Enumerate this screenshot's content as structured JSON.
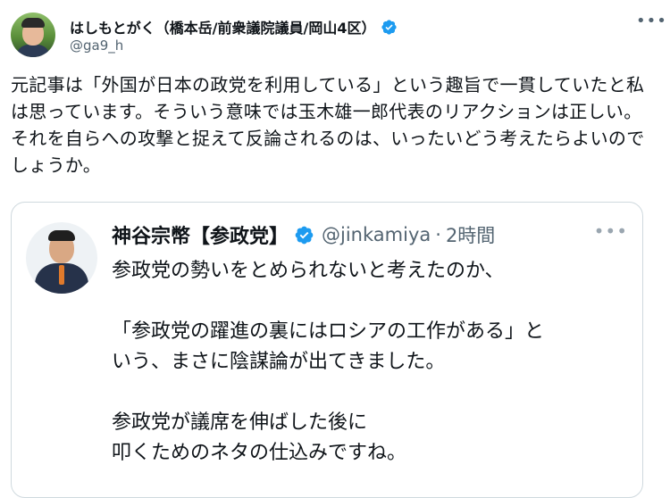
{
  "tweet": {
    "author_name": "はしもとがく（橋本岳/前衆議院議員/岡山4区）",
    "author_handle": "@ga9_h",
    "text": "元記事は「外国が日本の政党を利用している」という趣旨で一貫していたと私は思っています。そういう意味では玉木雄一郎代表のリアクションは正しい。それを自らへの攻撃と捉えて反論されるのは、いったいどう考えたらよいのでしょうか。",
    "more_icon": "more-horizontal-icon",
    "verified_icon": "verified-badge-icon"
  },
  "quoted_tweet": {
    "author_name": "神谷宗幣【参政党】",
    "author_handle": "@jinkamiya",
    "separator": "·",
    "time": "2時間",
    "more_icon": "more-horizontal-icon",
    "lines": [
      "参政党の勢いをとめられないと考えたのか、",
      "",
      "「参政党の躍進の裏にはロシアの工作がある」と",
      "いう、まさに陰謀論が出てきました。",
      "",
      "参政党が議席を伸ばした後に",
      "叩くためのネタの仕込みですね。"
    ]
  },
  "colors": {
    "verified_blue": "#1d9bf0",
    "text_primary": "#0f1419",
    "text_secondary": "#536471",
    "border": "#cfd9de"
  }
}
